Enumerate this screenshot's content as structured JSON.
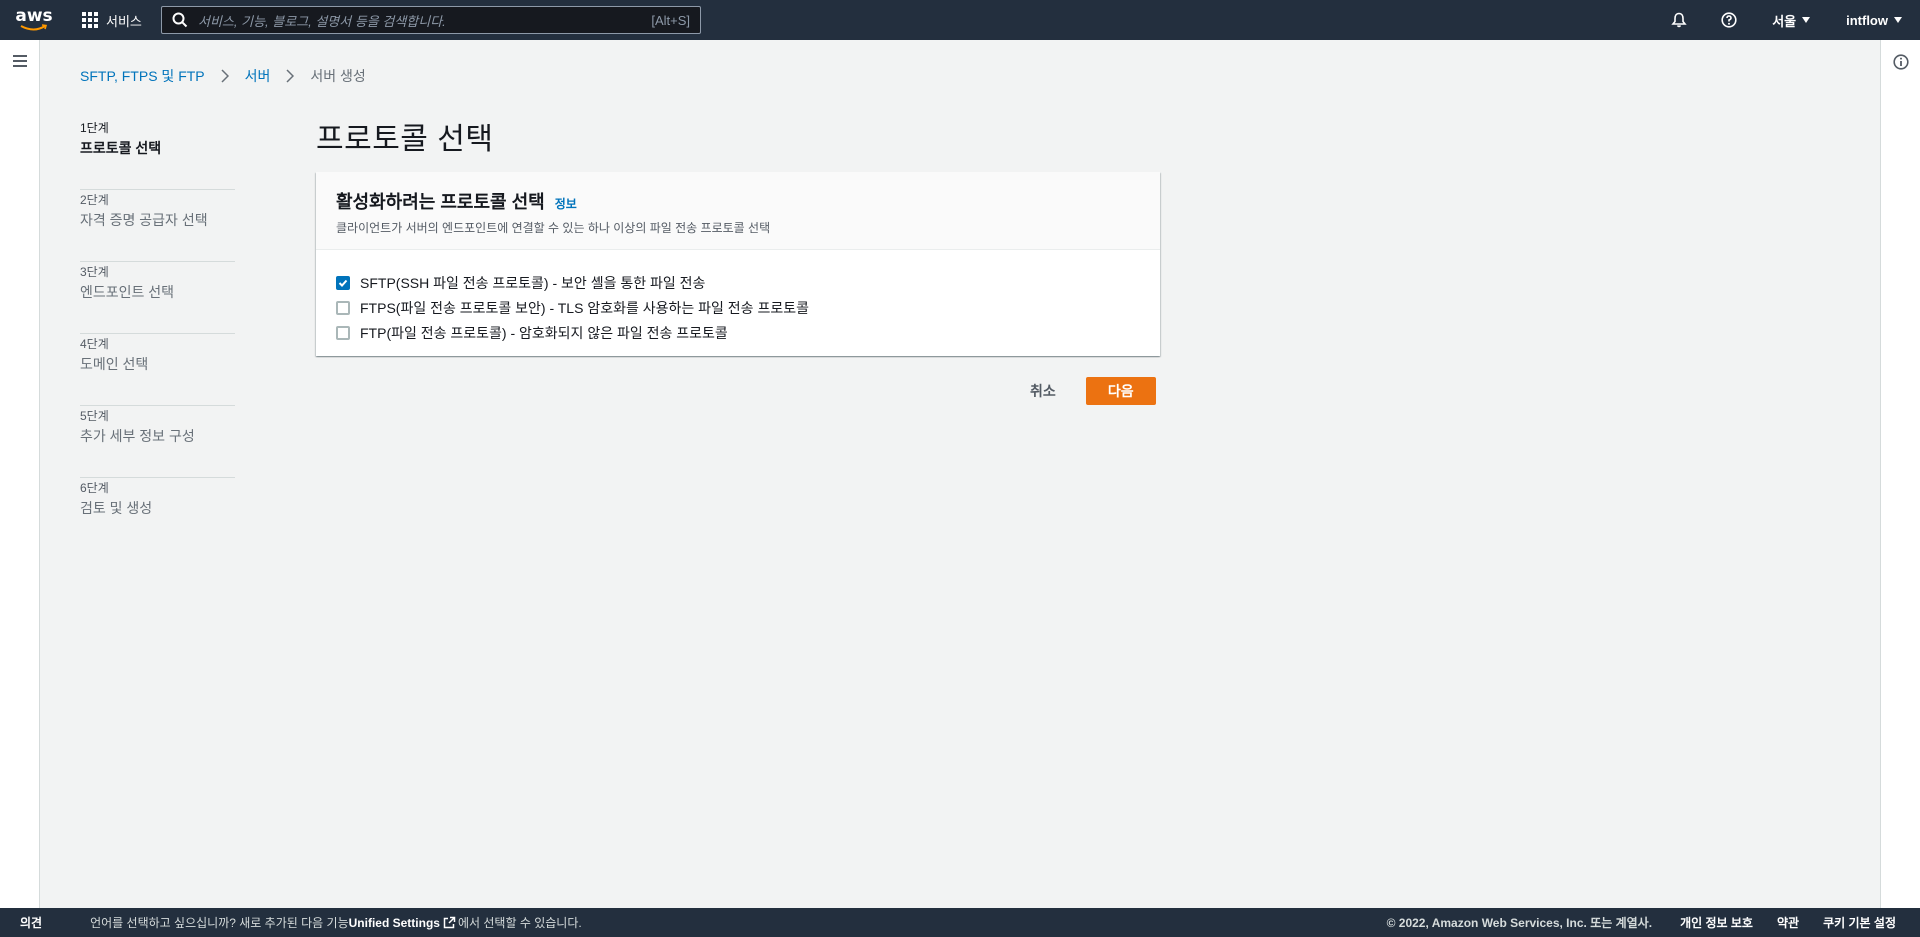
{
  "header": {
    "logo_text": "aws",
    "services_label": "서비스",
    "search_placeholder": "서비스, 기능, 블로그, 설명서 등을 검색합니다.",
    "search_shortcut": "[Alt+S]",
    "region_label": "서울",
    "account_label": "intflow"
  },
  "breadcrumb": {
    "items": [
      "SFTP, FTPS 및 FTP",
      "서버"
    ],
    "current": "서버 생성"
  },
  "steps": [
    {
      "num": "1단계",
      "label": "프로토콜 선택"
    },
    {
      "num": "2단계",
      "label": "자격 증명 공급자 선택"
    },
    {
      "num": "3단계",
      "label": "엔드포인트 선택"
    },
    {
      "num": "4단계",
      "label": "도메인 선택"
    },
    {
      "num": "5단계",
      "label": "추가 세부 정보 구성"
    },
    {
      "num": "6단계",
      "label": "검토 및 생성"
    }
  ],
  "main": {
    "title": "프로토콜 선택",
    "panel": {
      "title": "활성화하려는 프로토콜 선택",
      "info_link": "정보",
      "description": "클라이언트가 서버의 엔드포인트에 연결할 수 있는 하나 이상의 파일 전송 프로토콜 선택",
      "options": [
        {
          "label": "SFTP(SSH 파일 전송 프로토콜) - 보안 셸을 통한 파일 전송",
          "checked": true
        },
        {
          "label": "FTPS(파일 전송 프로토콜 보안) - TLS 암호화를 사용하는 파일 전송 프로토콜",
          "checked": false
        },
        {
          "label": "FTP(파일 전송 프로토콜) - 암호화되지 않은 파일 전송 프로토콜",
          "checked": false
        }
      ]
    },
    "cancel_label": "취소",
    "next_label": "다음"
  },
  "footer": {
    "feedback_label": "의견",
    "message_prefix": "언어를 선택하고 싶으십니까? 새로 추가된 다음 기능",
    "unified_settings": "Unified Settings",
    "message_suffix": "에서 선택할 수 있습니다.",
    "copyright": "© 2022, Amazon Web Services, Inc. 또는 계열사.",
    "links": [
      "개인 정보 보호",
      "약관",
      "쿠키 기본 설정"
    ]
  },
  "colors": {
    "nav_bg": "#232f3e",
    "link": "#0073bb",
    "primary_button": "#ec7211",
    "checkbox_checked": "#0073bb"
  }
}
